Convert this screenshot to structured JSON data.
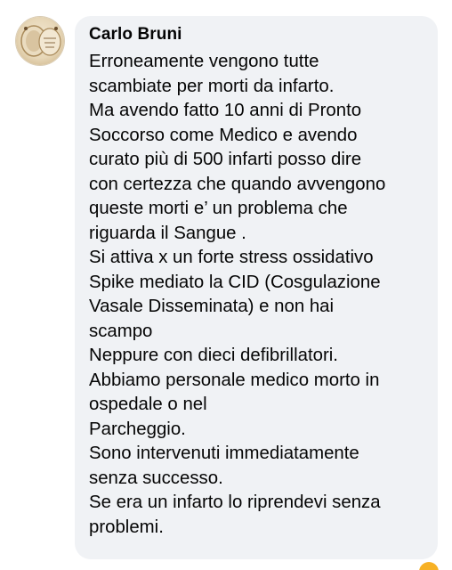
{
  "comment": {
    "author": "Carlo Bruni",
    "lines": [
      "Erroneamente vengono tutte",
      "scambiate per morti da infarto.",
      "Ma avendo fatto 10 anni di Pronto",
      "Soccorso come Medico e avendo",
      "curato più di 500 infarti posso dire",
      "con certezza che quando avvengono",
      "queste morti e’ un problema che",
      "riguarda il Sangue .",
      "Si attiva x un forte stress ossidativo",
      "Spike mediato la CID (Cosgulazione",
      "Vasale Disseminata) e non hai",
      "scampo",
      "Neppure con dieci defibrillatori.",
      "Abbiamo personale medico morto in",
      "ospedale o nel",
      "Parcheggio.",
      "Sono intervenuti immediatamente",
      "senza successo.",
      "Se era un infarto lo riprendevi senza",
      "problemi."
    ]
  },
  "avatar": {
    "icon": "profile-picture"
  },
  "reaction": {
    "icon": "emoji-reaction-icon",
    "color": "#f7b125"
  },
  "colors": {
    "bubble": "#f0f2f5",
    "text": "#050505"
  }
}
